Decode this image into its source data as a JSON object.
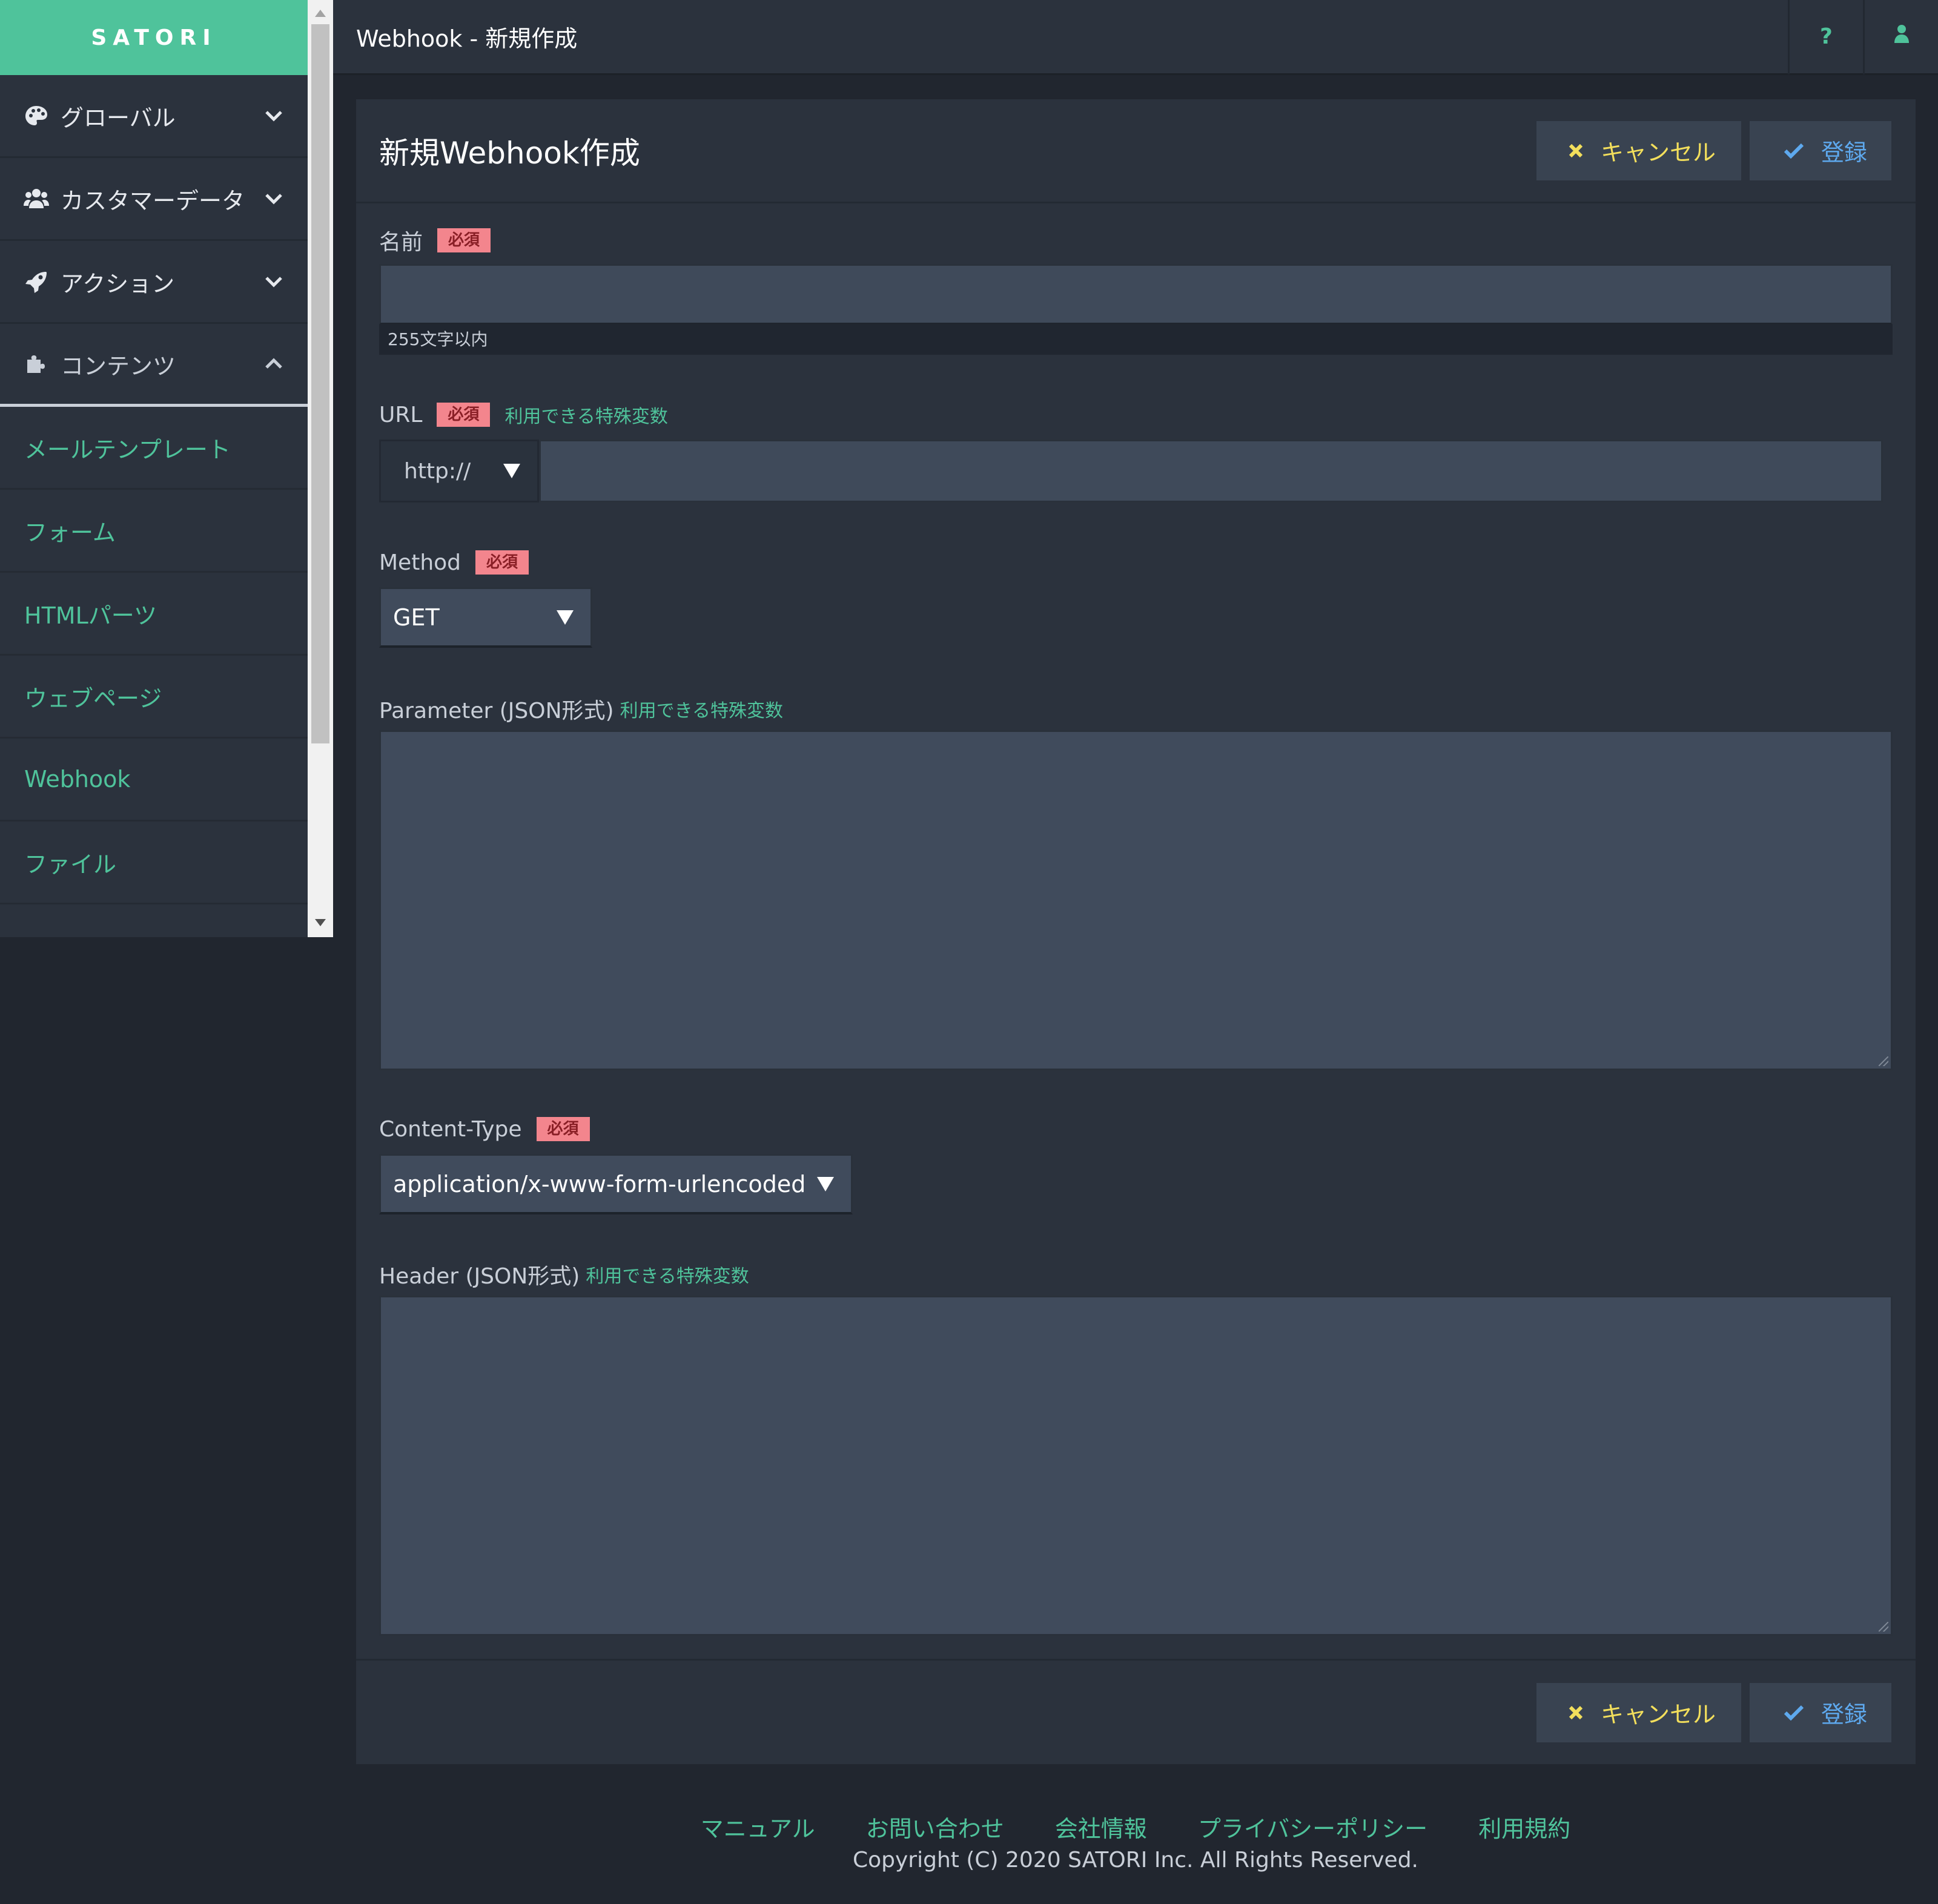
{
  "sidebar": {
    "brand": "SATORI",
    "groups": [
      {
        "label": "グローバル",
        "icon": "palette-icon",
        "open": false
      },
      {
        "label": "カスタマーデータ",
        "icon": "users-icon",
        "open": false
      },
      {
        "label": "アクション",
        "icon": "rocket-icon",
        "open": false
      },
      {
        "label": "コンテンツ",
        "icon": "puzzle-icon",
        "open": true
      }
    ],
    "sub_items": [
      {
        "label": "メールテンプレート"
      },
      {
        "label": "フォーム"
      },
      {
        "label": "HTMLパーツ"
      },
      {
        "label": "ウェブページ"
      },
      {
        "label": "Webhook"
      },
      {
        "label": "ファイル"
      }
    ]
  },
  "topbar": {
    "title": "Webhook - 新規作成",
    "help_label": "?",
    "user_icon": "user-icon"
  },
  "panel": {
    "title": "新規Webhook作成",
    "cancel_label": "キャンセル",
    "submit_label": "登録"
  },
  "form": {
    "required_badge": "必須",
    "special_vars_link": "利用できる特殊変数",
    "name": {
      "label": "名前",
      "value": "",
      "hint": "255文字以内"
    },
    "url": {
      "label": "URL",
      "scheme": "http://",
      "value": ""
    },
    "method": {
      "label": "Method",
      "value": "GET"
    },
    "parameter": {
      "label": "Parameter (JSON形式)",
      "value": ""
    },
    "content_type": {
      "label": "Content-Type",
      "value": "application/x-www-form-urlencoded"
    },
    "header": {
      "label": "Header (JSON形式)",
      "value": ""
    }
  },
  "footer": {
    "links": [
      "マニュアル",
      "お問い合わせ",
      "会社情報",
      "プライバシーポリシー",
      "利用規約"
    ],
    "copyright": "Copyright (C) 2020 SATORI Inc. All Rights Reserved."
  },
  "colors": {
    "accent": "#4fc39b",
    "cancel": "#f3df5c",
    "submit": "#5ea9ee",
    "required_bg": "#f3858d"
  }
}
